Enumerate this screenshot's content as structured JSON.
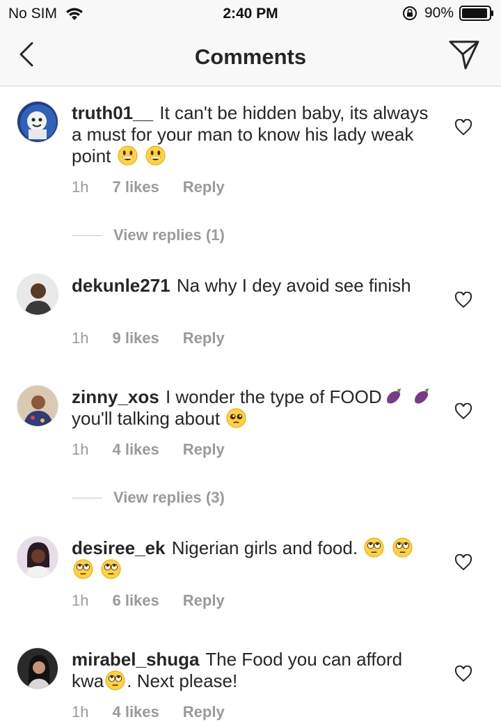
{
  "status_bar": {
    "carrier": "No SIM",
    "time": "2:40 PM",
    "battery": "90%"
  },
  "nav": {
    "title": "Comments"
  },
  "comments": [
    {
      "username": "truth01__",
      "text": "It can't be hidden baby, its always a must for your man to know his lady weak point",
      "time": "1h",
      "likes": "7 likes",
      "reply": "Reply",
      "view_replies": "View replies (1)"
    },
    {
      "username": "dekunle271",
      "text": "Na why I dey avoid see finish",
      "time": "1h",
      "likes": "9 likes",
      "reply": "Reply"
    },
    {
      "username": "zinny_xos",
      "text": "I wonder the type of FOOD",
      "text2": "you'll talking about",
      "time": "1h",
      "likes": "4 likes",
      "reply": "Reply",
      "view_replies": "View replies (3)"
    },
    {
      "username": "desiree_ek",
      "text": "Nigerian girls and food.",
      "time": "1h",
      "likes": "6 likes",
      "reply": "Reply"
    },
    {
      "username": "mirabel_shuga",
      "text": "The Food you can afford kwa",
      "text2": ". Next please!",
      "time": "1h",
      "likes": "4 likes",
      "reply": "Reply"
    }
  ],
  "colors": {
    "text": "#262626",
    "meta": "#9a9a9a",
    "bar_bg": "#f8f8f8"
  }
}
